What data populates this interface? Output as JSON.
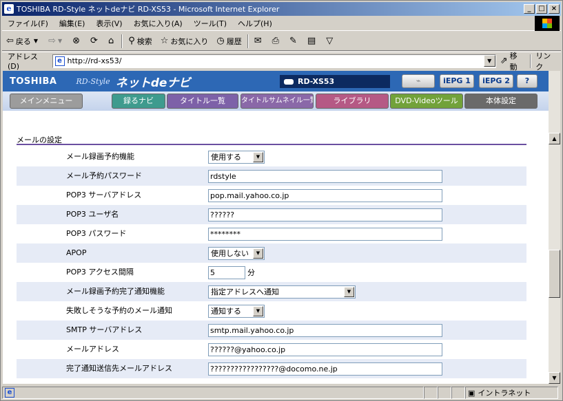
{
  "window": {
    "title": "TOSHIBA RD-Style ネットdeナビ RD-XS53 - Microsoft Internet Explorer",
    "minimize": "_",
    "maximize": "□",
    "close": "×"
  },
  "menubar": {
    "items": [
      "ファイル(F)",
      "編集(E)",
      "表示(V)",
      "お気に入り(A)",
      "ツール(T)",
      "ヘルプ(H)"
    ]
  },
  "toolbar": {
    "back": "戻る",
    "search": "検索",
    "favorites": "お気に入り",
    "history": "履歴"
  },
  "addressbar": {
    "label": "アドレス(D)",
    "url": "http://rd-xs53/",
    "go": "移動",
    "links": "リンク"
  },
  "app": {
    "brand": "TOSHIBA",
    "rdstyle": "RD-Style",
    "title": "ネットdeナビ",
    "model": "RD-XS53",
    "iepg1": "iEPG 1",
    "iepg2": "iEPG 2",
    "help": "?"
  },
  "nav": {
    "main_menu": "メインメニュー",
    "record": "録るナビ",
    "title_list": "タイトル一覧",
    "thumbnail": "タイトルサムネイル一覧",
    "library": "ライブラリ",
    "dvd_video": "DVD-Videoツール",
    "settings": "本体設定"
  },
  "section": {
    "title": "メールの設定"
  },
  "form": {
    "mail_record": {
      "label": "メール録画予約機能",
      "value": "使用する"
    },
    "mail_password": {
      "label": "メール予約パスワード",
      "value": "rdstyle"
    },
    "pop3_server": {
      "label": "POP3 サーバアドレス",
      "value": "pop.mail.yahoo.co.jp"
    },
    "pop3_user": {
      "label": "POP3 ユーザ名",
      "value": "??????"
    },
    "pop3_password": {
      "label": "POP3 パスワード",
      "value": "********"
    },
    "apop": {
      "label": "APOP",
      "value": "使用しない"
    },
    "pop3_interval": {
      "label": "POP3 アクセス間隔",
      "value": "5",
      "unit": "分"
    },
    "completion_notify": {
      "label": "メール録画予約完了通知機能",
      "value": "指定アドレスへ通知"
    },
    "fail_notify": {
      "label": "失敗しそうな予約のメール通知",
      "value": "通知する"
    },
    "smtp_server": {
      "label": "SMTP サーバアドレス",
      "value": "smtp.mail.yahoo.co.jp"
    },
    "mail_address": {
      "label": "メールアドレス",
      "value": "??????@yahoo.co.jp"
    },
    "notify_dest": {
      "label": "完了通知送信先メールアドレス",
      "value": "?????????????????@docomo.ne.jp"
    }
  },
  "statusbar": {
    "zone": "イントラネット"
  },
  "colors": {
    "header_blue": "#2d68b5",
    "section_rule": "#6a4fa0"
  }
}
